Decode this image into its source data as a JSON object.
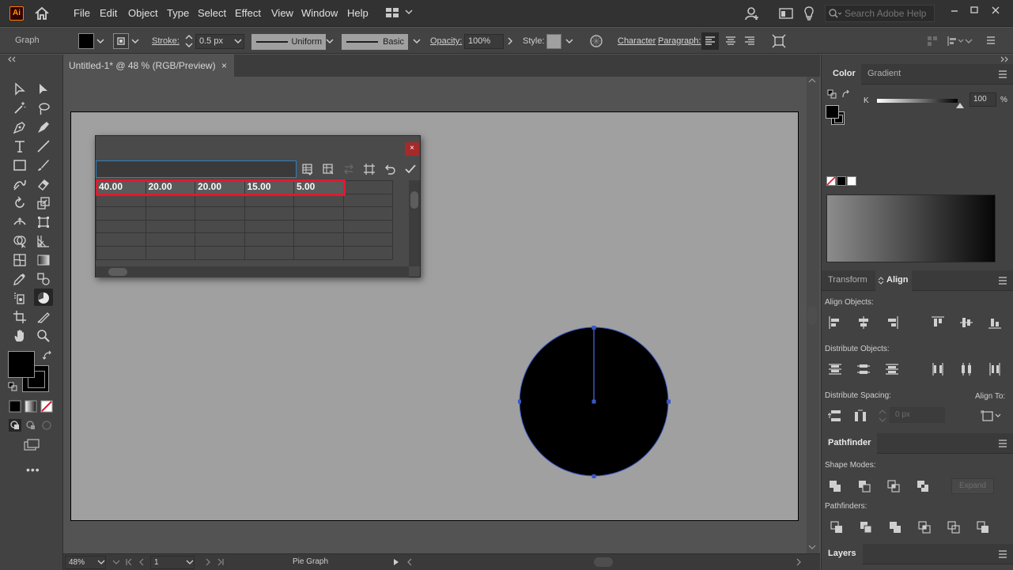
{
  "app": {
    "logo_text": "Ai",
    "menus": [
      "File",
      "Edit",
      "Object",
      "Type",
      "Select",
      "Effect",
      "View",
      "Window",
      "Help"
    ],
    "search_placeholder": "Search Adobe Help"
  },
  "control_bar": {
    "label": "Graph",
    "stroke_label": "Stroke:",
    "stroke_weight": "0.5 px",
    "variable_width_profile": "Uniform",
    "brush_definition": "Basic",
    "opacity_label": "Opacity:",
    "opacity_value": "100%",
    "style_label": "Style:",
    "character_link": "Character",
    "paragraph_link": "Paragraph:"
  },
  "document_tab": {
    "title": "Untitled-1* @ 48 % (RGB/Preview)",
    "close": "×"
  },
  "graph_dialog": {
    "close": "×",
    "cell_entry_value": "",
    "row_1": [
      "40.00",
      "20.00",
      "20.00",
      "15.00",
      "5.00"
    ],
    "empty_rows": 5,
    "columns": 6
  },
  "chart_data": {
    "type": "pie",
    "values": [
      40,
      20,
      20,
      15,
      5
    ],
    "rendered_state": "single black circle with one radius line (slices not yet separated)"
  },
  "color_panel": {
    "tabs": [
      "Color",
      "Gradient"
    ],
    "k_label": "K",
    "k_value": "100",
    "k_unit": "%",
    "fill_color": "#000000",
    "stroke_color": "#000000"
  },
  "align_panel": {
    "tabs": [
      "Transform",
      "Align"
    ],
    "align_objects_label": "Align Objects:",
    "distribute_objects_label": "Distribute Objects:",
    "distribute_spacing_label": "Distribute Spacing:",
    "align_to_label": "Align To:",
    "spacing_value": "0 px"
  },
  "pathfinder_panel": {
    "title": "Pathfinder",
    "shape_modes_label": "Shape Modes:",
    "pathfinders_label": "Pathfinders:",
    "expand_label": "Expand"
  },
  "layers_panel": {
    "title": "Layers"
  },
  "status_bar": {
    "zoom": "48%",
    "page": "1",
    "tool_name": "Pie Graph"
  },
  "colors": {
    "selection_blue": "#3a56c7",
    "highlight_red": "#e0192f",
    "artboard_gray": "#a0a0a0"
  }
}
